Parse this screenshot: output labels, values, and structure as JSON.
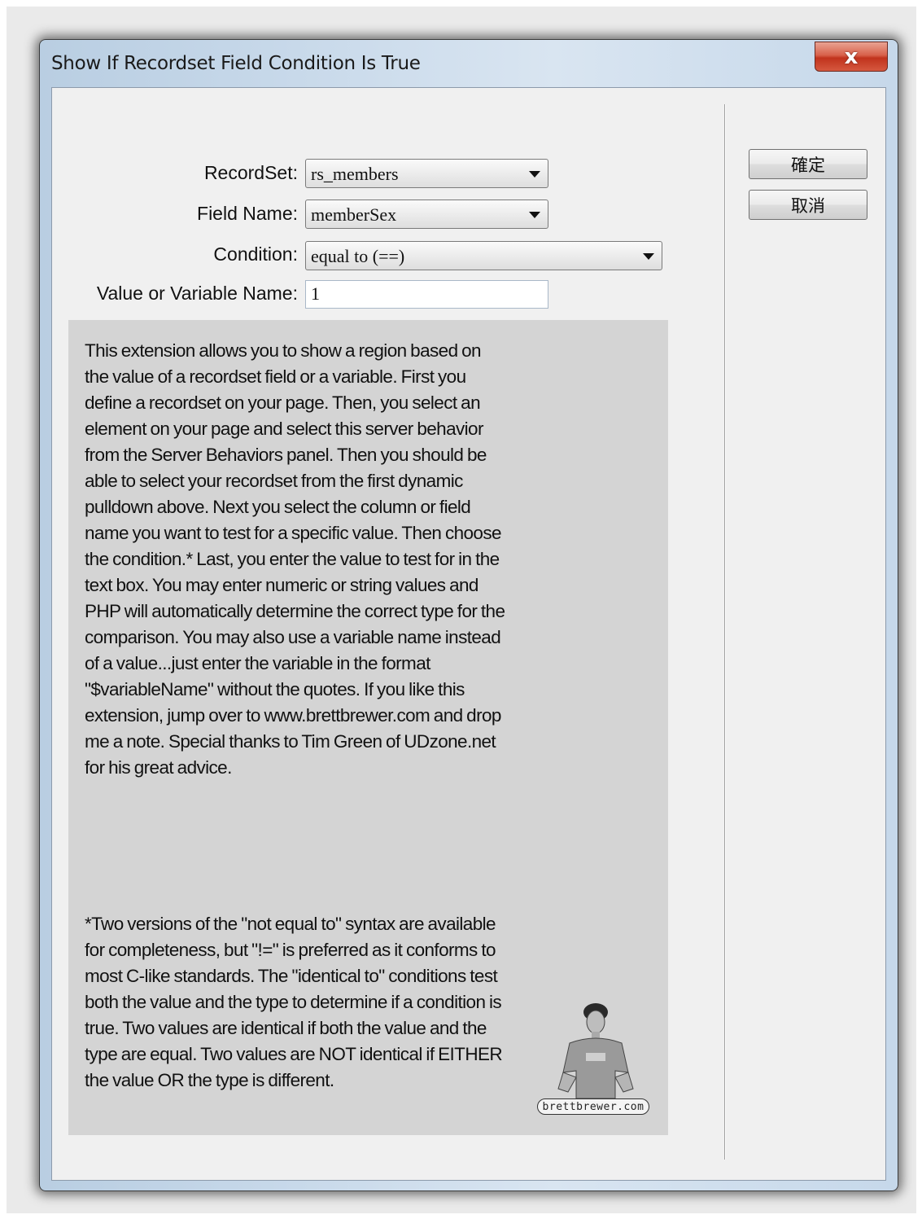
{
  "window": {
    "title": "Show If Recordset Field Condition Is True",
    "close_glyph": "x"
  },
  "form": {
    "recordset": {
      "label": "RecordSet:",
      "value": "rs_members"
    },
    "field_name": {
      "label": "Field Name:",
      "value": "memberSex"
    },
    "condition": {
      "label": "Condition:",
      "value": "equal to (==)"
    },
    "value_name": {
      "label": "Value or Variable Name:",
      "value": "1"
    }
  },
  "buttons": {
    "ok": "確定",
    "cancel": "取消"
  },
  "description": {
    "paragraph1": "This extension allows you to show a region based on the value of a recordset field or a variable. First you define a recordset on your page. Then, you select an element on your page and select this server behavior from the Server Behaviors panel. Then you should be able to select your recordset from the first dynamic pulldown above. Next you select the column or field name you want to test for a specific value. Then choose the condition.* Last, you enter the value to test for in the text box. You may enter numeric or string values and PHP will automatically determine the correct type for the comparison. You may also use a variable name instead of a value...just enter the variable in the format \"$variableName\" without the quotes. If you like this extension, jump over to www.brettbrewer.com and drop me a note. Special thanks to Tim Green of UDzone.net for his great advice.",
    "paragraph2": "*Two versions of the \"not equal to\" syntax are available for completeness, but \"!=\" is preferred as it conforms to most C-like standards. The \"identical to\" conditions test both the value and the type to determine if a condition is true. Two values are identical if both the value and the type are equal. Two values are NOT identical if EITHER the value OR the type is different."
  },
  "logo": {
    "text": "brettbrewer.com",
    "icon": "person-figure-icon"
  }
}
